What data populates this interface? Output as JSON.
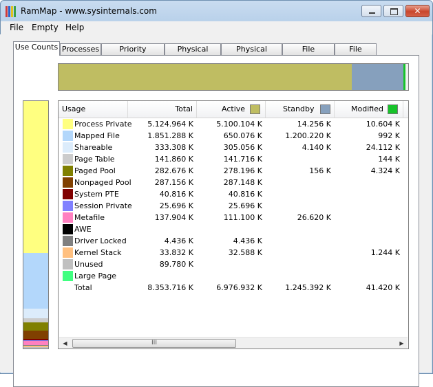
{
  "window": {
    "title": "RamMap - www.sysinternals.com"
  },
  "menu": [
    "File",
    "Empty",
    "Help"
  ],
  "tabs": [
    "Use Counts",
    "Processes",
    "Priority Summary",
    "Physical Pages",
    "Physical Ranges",
    "File Summary",
    "File Details"
  ],
  "active_tab": "Use Counts",
  "columns": {
    "usage": "Usage",
    "total": "Total",
    "active": "Active",
    "standby": "Standby",
    "modified": "Modified"
  },
  "column_colors": {
    "active": "#bfbd62",
    "standby": "#86a0bd",
    "modified": "#17c32a"
  },
  "rows": [
    {
      "name": "Process Private",
      "color": "#ffff80",
      "total": "5.124.964 K",
      "active": "5.100.104 K",
      "standby": "14.256 K",
      "modified": "10.604 K"
    },
    {
      "name": "Mapped File",
      "color": "#b3d7fb",
      "total": "1.851.288 K",
      "active": "650.076 K",
      "standby": "1.200.220 K",
      "modified": "992 K"
    },
    {
      "name": "Shareable",
      "color": "#dcecfb",
      "total": "333.308 K",
      "active": "305.056 K",
      "standby": "4.140 K",
      "modified": "24.112 K"
    },
    {
      "name": "Page Table",
      "color": "#cccccc",
      "total": "141.860 K",
      "active": "141.716 K",
      "standby": "",
      "modified": "144 K"
    },
    {
      "name": "Paged Pool",
      "color": "#808000",
      "total": "282.676 K",
      "active": "278.196 K",
      "standby": "156 K",
      "modified": "4.324 K"
    },
    {
      "name": "Nonpaged Pool",
      "color": "#804000",
      "total": "287.156 K",
      "active": "287.148 K",
      "standby": "",
      "modified": ""
    },
    {
      "name": "System PTE",
      "color": "#800000",
      "total": "40.816 K",
      "active": "40.816 K",
      "standby": "",
      "modified": ""
    },
    {
      "name": "Session Private",
      "color": "#8080ff",
      "total": "25.696 K",
      "active": "25.696 K",
      "standby": "",
      "modified": ""
    },
    {
      "name": "Metafile",
      "color": "#ff80c0",
      "total": "137.904 K",
      "active": "111.100 K",
      "standby": "26.620 K",
      "modified": ""
    },
    {
      "name": "AWE",
      "color": "#000000",
      "total": "",
      "active": "",
      "standby": "",
      "modified": ""
    },
    {
      "name": "Driver Locked",
      "color": "#808080",
      "total": "4.436 K",
      "active": "4.436 K",
      "standby": "",
      "modified": ""
    },
    {
      "name": "Kernel Stack",
      "color": "#ffc080",
      "total": "33.832 K",
      "active": "32.588 K",
      "standby": "",
      "modified": "1.244 K"
    },
    {
      "name": "Unused",
      "color": "#c0c0c0",
      "total": "89.780 K",
      "active": "",
      "standby": "",
      "modified": ""
    },
    {
      "name": "Large Page",
      "color": "#40ff80",
      "total": "",
      "active": "",
      "standby": "",
      "modified": ""
    }
  ],
  "total_row": {
    "name": "Total",
    "total": "8.353.716 K",
    "active": "6.976.932 K",
    "standby": "1.245.392 K",
    "modified": "41.420 K"
  },
  "scroll_grip": "III"
}
